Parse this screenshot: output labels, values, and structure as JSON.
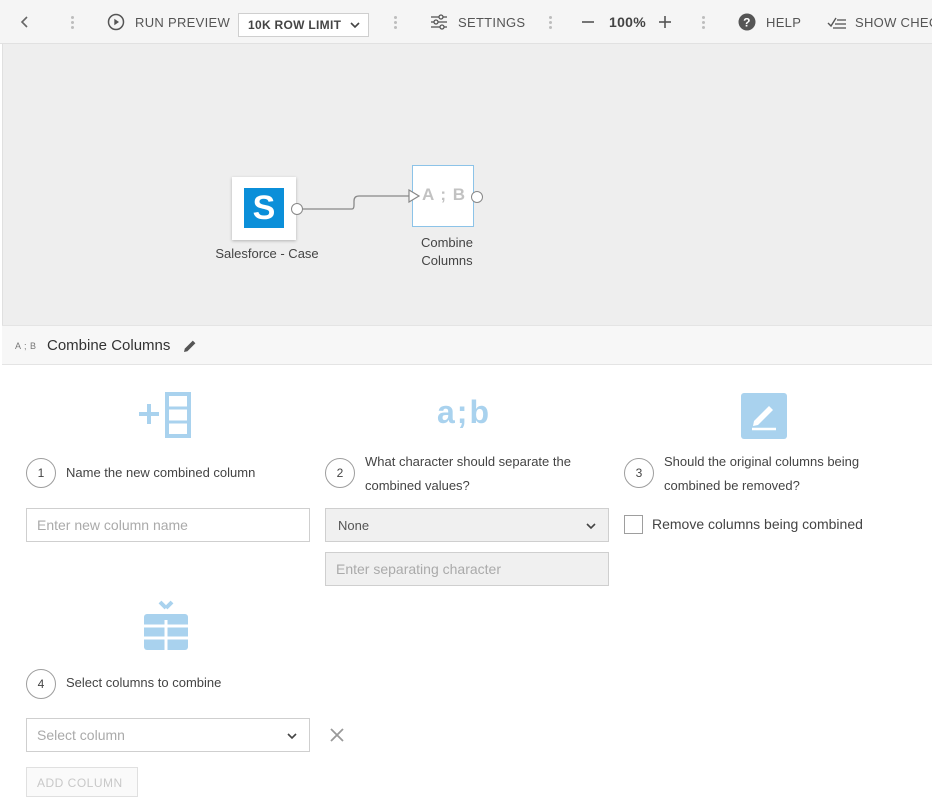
{
  "toolbar": {
    "run_preview": "RUN PREVIEW",
    "row_limit": "10K ROW LIMIT",
    "settings": "SETTINGS",
    "zoom": "100%",
    "help": "HELP",
    "show_checks": "SHOW CHEC"
  },
  "canvas": {
    "nodes": [
      {
        "label": "Salesforce - Case",
        "icon_letter": "S"
      },
      {
        "label_line1": "Combine",
        "label_line2": "Columns",
        "icon_text": "A ; B"
      }
    ]
  },
  "panel": {
    "header_icon_text": "A ; B",
    "title": "Combine Columns",
    "step1": {
      "number": "1",
      "label": "Name the new combined column",
      "placeholder": "Enter new column name"
    },
    "step2": {
      "number": "2",
      "label_line1": "What character should separate the",
      "label_line2": "combined values?",
      "separator_value": "None",
      "separator_placeholder": "Enter separating character",
      "icon_text": "a;b"
    },
    "step3": {
      "number": "3",
      "label_line1": "Should the original columns being",
      "label_line2": "combined be removed?",
      "checkbox_label": "Remove columns being combined"
    },
    "step4": {
      "number": "4",
      "label": "Select columns to combine",
      "select_placeholder": "Select column"
    },
    "add_column": "ADD COLUMN"
  },
  "colors": {
    "accent_blue": "#a9d2ee",
    "salesforce_blue": "#0b8fd9"
  }
}
